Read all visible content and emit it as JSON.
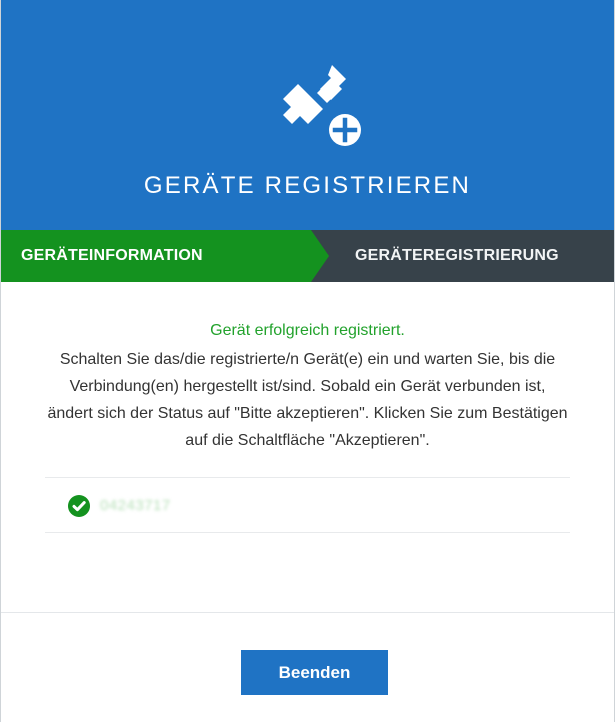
{
  "header": {
    "icon": "device-plug-plus-icon",
    "title": "GERÄTE REGISTRIEREN",
    "color": "#1f73c4"
  },
  "steps": [
    {
      "label": "GERÄTEINFORMATION",
      "active": true,
      "color": "#14921f"
    },
    {
      "label": "GERÄTEREGISTRIERUNG",
      "active": false,
      "color": "#37424a"
    }
  ],
  "content": {
    "success_message": "Gerät erfolgreich registriert.",
    "instruction": "Schalten Sie das/die registrierte/n Gerät(e) ein und warten Sie, bis die Verbindung(en) hergestellt ist/sind. Sobald ein Gerät verbunden ist, ändert sich der Status auf \"Bitte akzeptieren\". Klicken Sie zum Bestätigen auf die Schaltfläche \"Akzeptieren\".",
    "device": {
      "status_icon": "check-circle-icon",
      "id": "04243717",
      "status_color": "#14921f"
    }
  },
  "actions": {
    "finish_label": "Beenden"
  }
}
